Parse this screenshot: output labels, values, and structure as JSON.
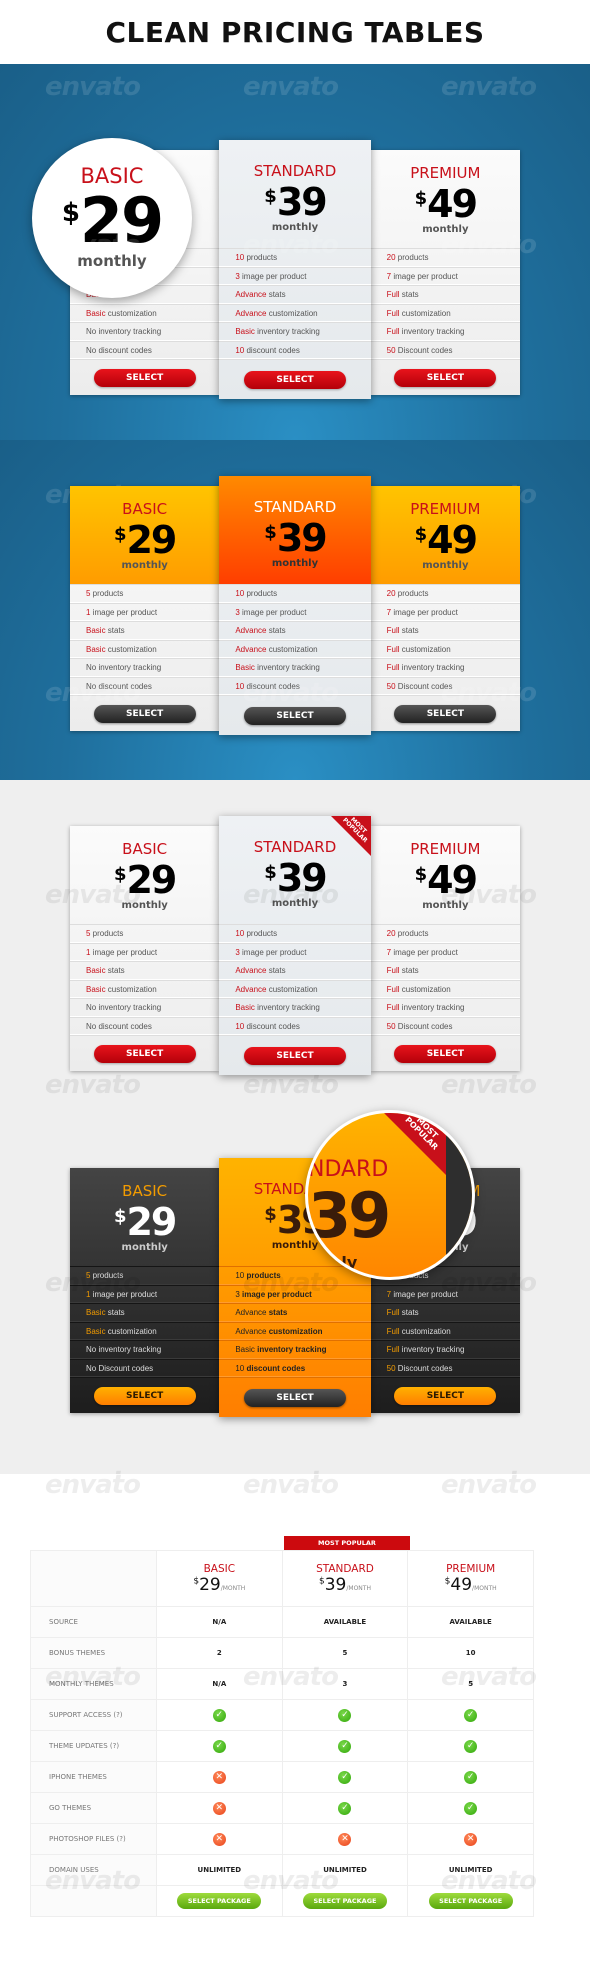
{
  "title": "CLEAN PRICING TABLES",
  "watermark": "envato",
  "colors": {
    "accent_red": "#c8101a",
    "blue_bg": "#1f6f9d",
    "orange": "#ff8a00",
    "dark": "#2a2a2a",
    "green": "#5aa80e"
  },
  "plans": [
    {
      "name": "BASIC",
      "currency": "$",
      "price": "29",
      "period": "monthly",
      "features": [
        {
          "hl": "5",
          "text": " products"
        },
        {
          "hl": "1",
          "text": " image per product"
        },
        {
          "hl": "Basic",
          "text": " stats"
        },
        {
          "hl": "Basic",
          "text": " customization"
        },
        {
          "hl": "",
          "text": "No inventory tracking"
        },
        {
          "hl": "",
          "text": "No discount codes"
        }
      ],
      "button": "SELECT"
    },
    {
      "name": "STANDARD",
      "currency": "$",
      "price": "39",
      "period": "monthly",
      "features": [
        {
          "hl": "10",
          "text": " products"
        },
        {
          "hl": "3",
          "text": " image per product"
        },
        {
          "hl": "Advance",
          "text": " stats"
        },
        {
          "hl": "Advance",
          "text": " customization"
        },
        {
          "hl": "Basic",
          "text": " inventory tracking"
        },
        {
          "hl": "10",
          "text": " discount codes"
        }
      ],
      "button": "SELECT"
    },
    {
      "name": "PREMIUM",
      "currency": "$",
      "price": "49",
      "period": "monthly",
      "features": [
        {
          "hl": "20",
          "text": " products"
        },
        {
          "hl": "7",
          "text": " image per product"
        },
        {
          "hl": "Full",
          "text": " stats"
        },
        {
          "hl": "Full",
          "text": " customization"
        },
        {
          "hl": "Full",
          "text": " inventory tracking"
        },
        {
          "hl": "50",
          "text": " Discount codes"
        }
      ],
      "button": "SELECT"
    }
  ],
  "dark_basic_last_feature": "No Discount codes",
  "ribbon": "MOST POPULAR",
  "comparison": {
    "badge": "MOST POPULAR",
    "per": "/MONTH",
    "plans": [
      {
        "name": "BASIC",
        "currency": "$",
        "price": "29"
      },
      {
        "name": "STANDARD",
        "currency": "$",
        "price": "39"
      },
      {
        "name": "PREMIUM",
        "currency": "$",
        "price": "49"
      }
    ],
    "rows": [
      {
        "label": "SOURCE",
        "values": [
          "N/A",
          "AVAILABLE",
          "AVAILABLE"
        ]
      },
      {
        "label": "BONUS THEMES",
        "values": [
          "2",
          "5",
          "10"
        ]
      },
      {
        "label": "MONTHLY THEMES",
        "values": [
          "N/A",
          "3",
          "5"
        ]
      },
      {
        "label": "SUPPORT ACCESS (?)",
        "values": [
          "yes",
          "yes",
          "yes"
        ]
      },
      {
        "label": "THEME UPDATES (?)",
        "values": [
          "yes",
          "yes",
          "yes"
        ]
      },
      {
        "label": "IPHONE THEMES",
        "values": [
          "no",
          "yes",
          "yes"
        ]
      },
      {
        "label": "GO THEMES",
        "values": [
          "no",
          "yes",
          "yes"
        ]
      },
      {
        "label": "PHOTOSHOP FILES (?)",
        "values": [
          "no",
          "no",
          "no"
        ]
      },
      {
        "label": "DOMAIN USES",
        "values": [
          "UNLIMITED",
          "UNLIMITED",
          "UNLIMITED"
        ]
      }
    ],
    "button": "SELECT PACKAGE"
  }
}
